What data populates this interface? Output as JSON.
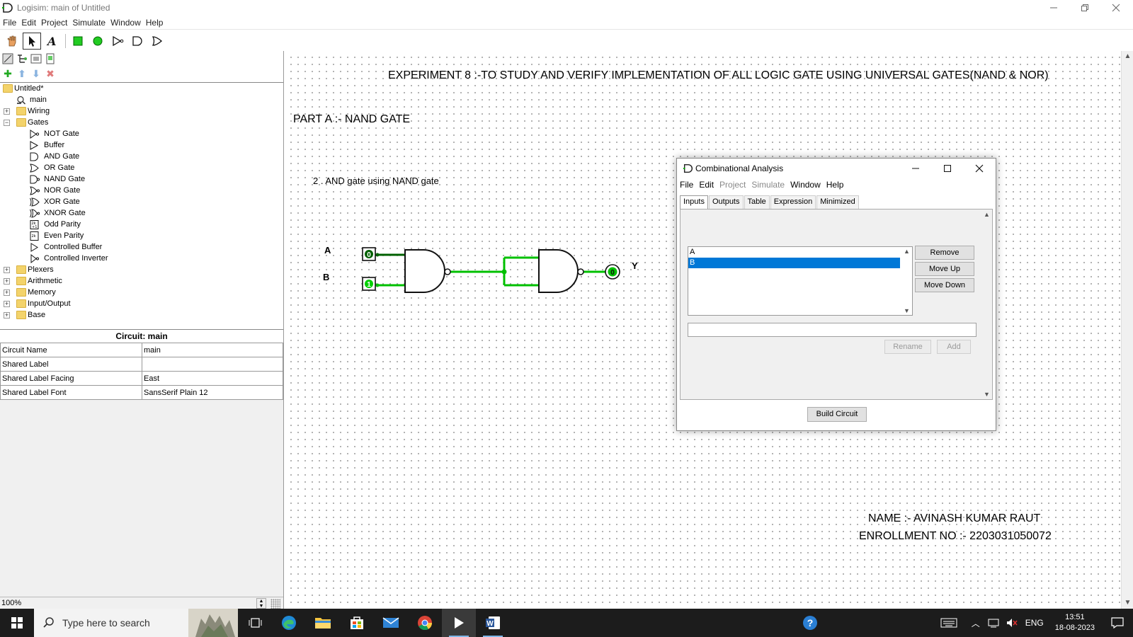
{
  "window": {
    "title": "Logisim: main of Untitled"
  },
  "menubar": {
    "items": [
      "File",
      "Edit",
      "Project",
      "Simulate",
      "Window",
      "Help"
    ]
  },
  "tree": {
    "root": "Untitled*",
    "circuit": "main",
    "folders": [
      "Wiring",
      "Gates",
      "Plexers",
      "Arithmetic",
      "Memory",
      "Input/Output",
      "Base"
    ],
    "gates": [
      "NOT Gate",
      "Buffer",
      "AND Gate",
      "OR Gate",
      "NAND Gate",
      "NOR Gate",
      "XOR Gate",
      "XNOR Gate",
      "Odd Parity",
      "Even Parity",
      "Controlled Buffer",
      "Controlled Inverter"
    ]
  },
  "properties": {
    "title": "Circuit: main",
    "rows": [
      {
        "key": "Circuit Name",
        "value": "main"
      },
      {
        "key": "Shared Label",
        "value": ""
      },
      {
        "key": "Shared Label Facing",
        "value": "East"
      },
      {
        "key": "Shared Label Font",
        "value": "SansSerif Plain 12"
      }
    ]
  },
  "zoom": "100%",
  "canvas": {
    "experiment_title": "EXPERIMENT 8 :-TO STUDY AND VERIFY IMPLEMENTATION OF ALL LOGIC GATE USING UNIVERSAL GATES(NAND & NOR)",
    "part_title": "PART  A :- NAND GATE",
    "subtitle": "2 . AND gate using NAND gate",
    "input_a_label": "A",
    "input_b_label": "B",
    "output_label": "Y",
    "input_a_value": "0",
    "input_b_value": "1",
    "output_value": "0",
    "name_line": "NAME :- AVINASH KUMAR RAUT",
    "enroll_line": "ENROLLMENT NO :- 2203031050072",
    "wire_color": "#00d000"
  },
  "dialog": {
    "title": "Combinational Analysis",
    "menu": [
      "File",
      "Edit",
      "Project",
      "Simulate",
      "Window",
      "Help"
    ],
    "tabs": [
      "Inputs",
      "Outputs",
      "Table",
      "Expression",
      "Minimized"
    ],
    "active_tab": "Inputs",
    "variables": [
      "A",
      "B"
    ],
    "selected_variable": "B",
    "buttons": {
      "remove": "Remove",
      "move_up": "Move Up",
      "move_down": "Move Down",
      "rename": "Rename",
      "add": "Add",
      "build": "Build Circuit"
    },
    "accent": "#0078d7"
  },
  "taskbar": {
    "search_placeholder": "Type here to search",
    "language": "ENG",
    "time": "13:51",
    "date": "18-08-2023"
  }
}
